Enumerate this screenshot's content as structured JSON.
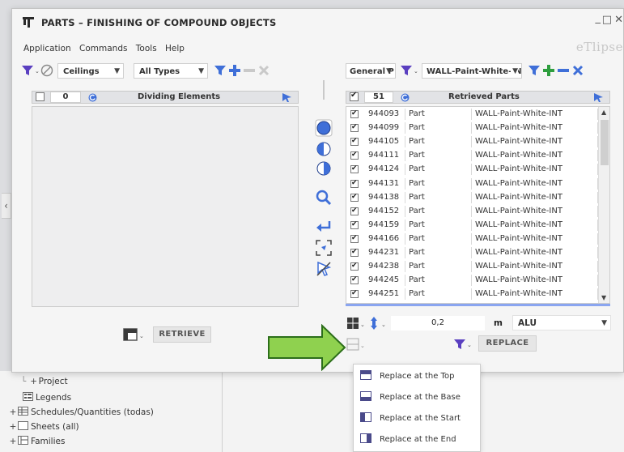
{
  "window": {
    "title": "PARTS – FINISHING OF COMPOUND OBJECTS",
    "brand": "eTlipse",
    "controls": {
      "minimize": "_",
      "maximize": "□",
      "close": "✕"
    }
  },
  "menu": [
    "Application",
    "Commands",
    "Tools",
    "Help"
  ],
  "left_panel": {
    "category_select": "Ceilings",
    "type_select": "All Types",
    "count": "0",
    "header_label": "Dividing Elements",
    "retrieve_label": "RETRIEVE"
  },
  "right_panel": {
    "filter_select": "General P",
    "name_select": "WALL-Paint-White-INT",
    "count": "51",
    "header_label": "Retrieved Parts",
    "rows": [
      {
        "id": "944093",
        "type": "Part",
        "name": "WALL-Paint-White-INT",
        "checked": true
      },
      {
        "id": "944099",
        "type": "Part",
        "name": "WALL-Paint-White-INT",
        "checked": true
      },
      {
        "id": "944105",
        "type": "Part",
        "name": "WALL-Paint-White-INT",
        "checked": true
      },
      {
        "id": "944111",
        "type": "Part",
        "name": "WALL-Paint-White-INT",
        "checked": true
      },
      {
        "id": "944124",
        "type": "Part",
        "name": "WALL-Paint-White-INT",
        "checked": true
      },
      {
        "id": "944131",
        "type": "Part",
        "name": "WALL-Paint-White-INT",
        "checked": true
      },
      {
        "id": "944138",
        "type": "Part",
        "name": "WALL-Paint-White-INT",
        "checked": true
      },
      {
        "id": "944152",
        "type": "Part",
        "name": "WALL-Paint-White-INT",
        "checked": true
      },
      {
        "id": "944159",
        "type": "Part",
        "name": "WALL-Paint-White-INT",
        "checked": true
      },
      {
        "id": "944166",
        "type": "Part",
        "name": "WALL-Paint-White-INT",
        "checked": true
      },
      {
        "id": "944231",
        "type": "Part",
        "name": "WALL-Paint-White-INT",
        "checked": true
      },
      {
        "id": "944238",
        "type": "Part",
        "name": "WALL-Paint-White-INT",
        "checked": true
      },
      {
        "id": "944245",
        "type": "Part",
        "name": "WALL-Paint-White-INT",
        "checked": true
      },
      {
        "id": "944251",
        "type": "Part",
        "name": "WALL-Paint-White-INT",
        "checked": true
      }
    ],
    "offset_value": "0,2",
    "unit": "m",
    "material_select": "ALU",
    "replace_label": "REPLACE"
  },
  "popup_menu": [
    {
      "label": "Replace at the Top",
      "icon": "replace-top-icon"
    },
    {
      "label": "Replace at the Base",
      "icon": "replace-base-icon"
    },
    {
      "label": "Replace at the Start",
      "icon": "replace-start-icon"
    },
    {
      "label": "Replace at the End",
      "icon": "replace-end-icon"
    }
  ],
  "browser_tree": [
    {
      "label": "Project",
      "prefix": "+"
    },
    {
      "label": "Legends",
      "prefix": ""
    },
    {
      "label": "Schedules/Quantities (todas)",
      "prefix": "+"
    },
    {
      "label": "Sheets (all)",
      "prefix": "+"
    },
    {
      "label": "Families",
      "prefix": "+"
    }
  ],
  "colors": {
    "accent_blue": "#3f6fd8",
    "filter_purple": "#5a3fc0",
    "add_green": "#2e9e3e",
    "arrow_green": "#8fd14f",
    "arrow_stroke": "#2c6e1a"
  }
}
